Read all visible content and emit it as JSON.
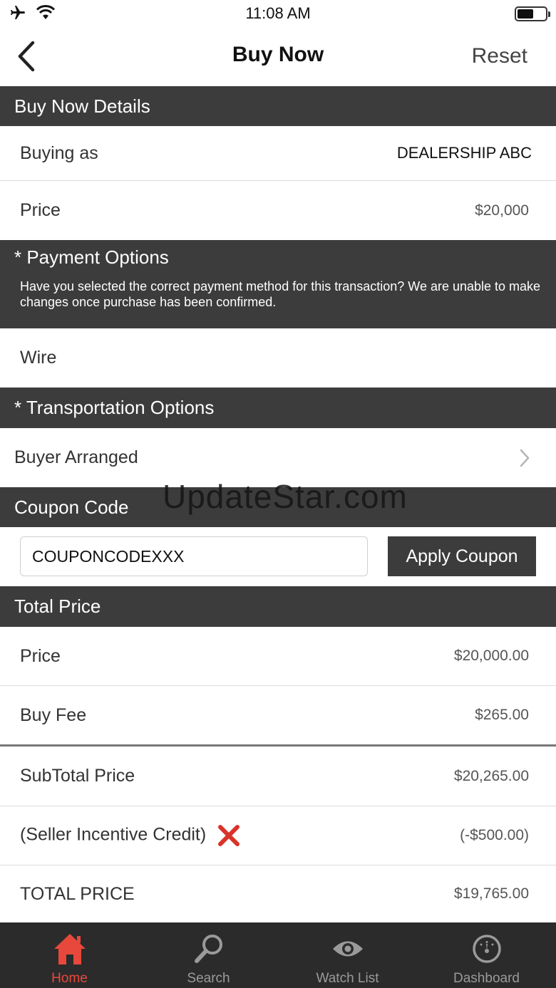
{
  "status_bar": {
    "time": "11:08 AM"
  },
  "nav": {
    "title": "Buy Now",
    "reset_label": "Reset"
  },
  "sections": {
    "details": "Buy Now Details",
    "payment": "* Payment Options",
    "payment_note": "Have you selected the correct payment method for this transaction? We are unable to make changes once purchase has been confirmed.",
    "transport": "* Transportation Options",
    "coupon": "Coupon Code",
    "total": "Total Price"
  },
  "details": {
    "buying_as_label": "Buying as",
    "buying_as_value": "DEALERSHIP ABC",
    "price_label": "Price",
    "price_value": "$20,000"
  },
  "payment": {
    "selected": "Wire"
  },
  "transport": {
    "selected": "Buyer Arranged"
  },
  "coupon": {
    "value": "COUPONCODEXXX",
    "apply_label": "Apply Coupon"
  },
  "totals": {
    "price_label": "Price",
    "price_value": "$20,000.00",
    "fee_label": "Buy Fee",
    "fee_value": "$265.00",
    "subtotal_label": "SubTotal Price",
    "subtotal_value": "$20,265.00",
    "credit_label": "(Seller Incentive Credit)",
    "credit_value": "(-$500.00)",
    "total_label": "TOTAL PRICE",
    "total_value": "$19,765.00"
  },
  "watermark": "UpdateStar.com",
  "tabs": [
    {
      "label": "Home",
      "icon": "home-icon",
      "active": true
    },
    {
      "label": "Search",
      "icon": "search-icon",
      "active": false
    },
    {
      "label": "Watch List",
      "icon": "eye-icon",
      "active": false
    },
    {
      "label": "Dashboard",
      "icon": "speedometer-icon",
      "active": false
    }
  ],
  "colors": {
    "header_bg": "#3c3c3c",
    "accent": "#e8483b",
    "tab_bg": "#2b2b2b"
  }
}
